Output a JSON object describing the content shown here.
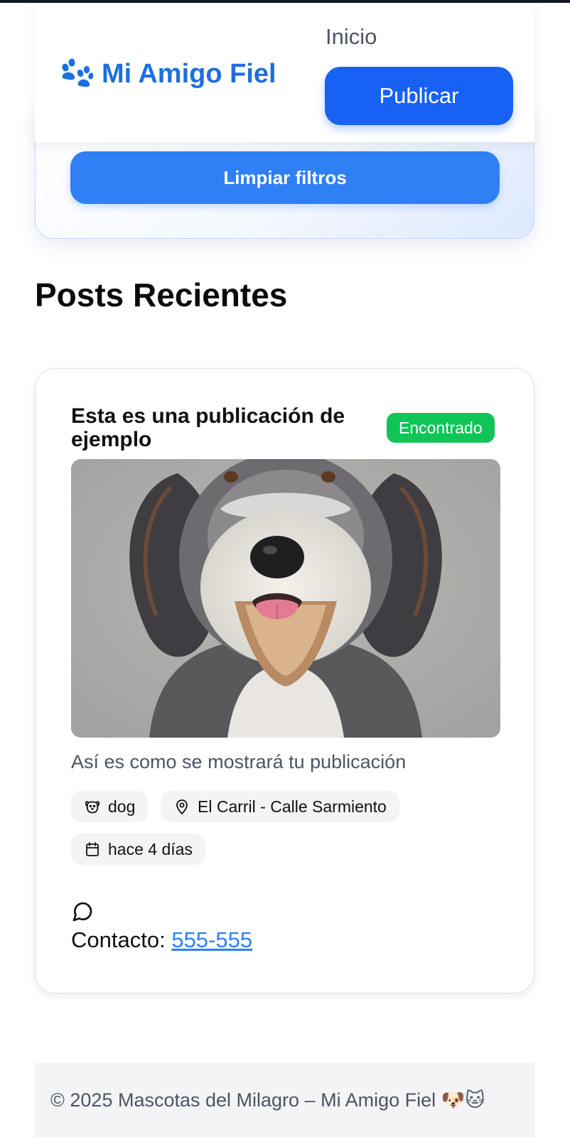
{
  "header": {
    "brand": "Mi Amigo Fiel",
    "brand_icon": "paw-icon",
    "nav_inicio": "Inicio",
    "publish_label": "Publicar"
  },
  "filters": {
    "clear_label": "Limpiar filtros"
  },
  "section_title": "Posts Recientes",
  "post": {
    "title": "Esta es una publicación de ejemplo",
    "status": "Encontrado",
    "description": "Así es como se mostrará tu publicación",
    "type": "dog",
    "location": "El Carril - Calle Sarmiento",
    "date": "hace 4 días",
    "contact_label": "Contacto:",
    "contact_phone": "555-555",
    "icons": [
      "dog-face-icon",
      "map-pin-icon",
      "calendar-icon",
      "chat-bubble-icon"
    ]
  },
  "footer": {
    "text": "© 2025 Mascotas del Milagro – Mi Amigo Fiel 🐶🐱"
  },
  "colors": {
    "brand": "#1d6fe0",
    "primary_button": "#1762f5",
    "secondary_button": "#2f7ff5",
    "badge_found": "#0fc558",
    "link": "#2f7ff5"
  }
}
